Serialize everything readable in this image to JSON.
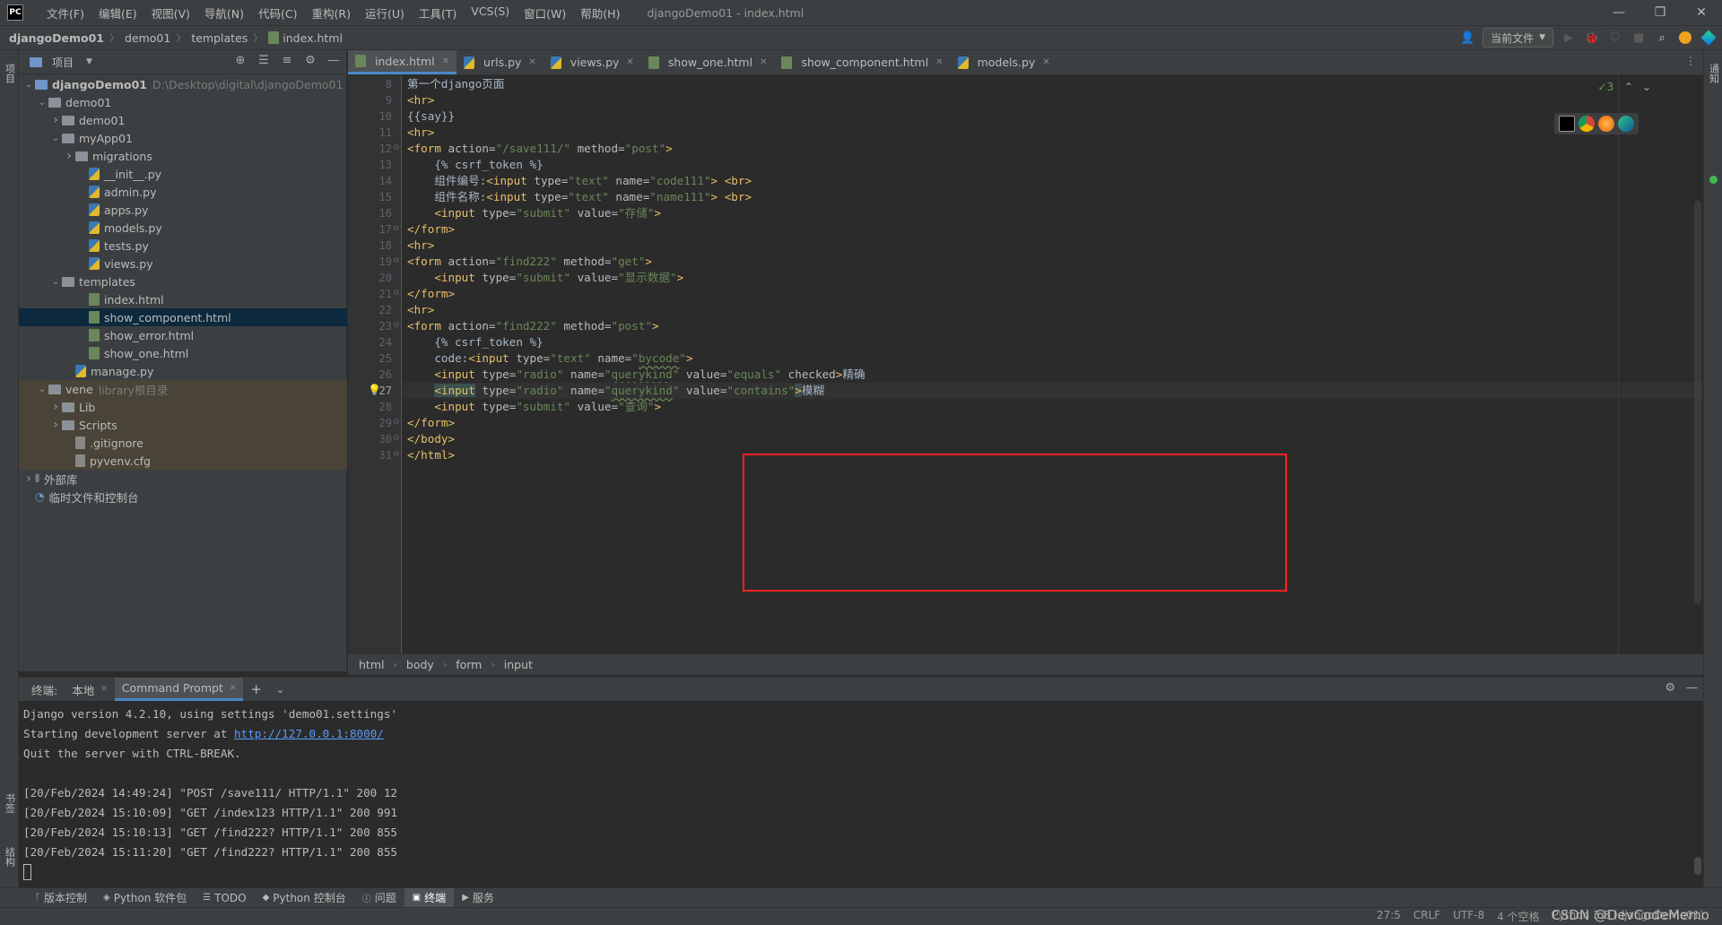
{
  "titlebar": {
    "logo": "PC",
    "menu": [
      "文件(F)",
      "编辑(E)",
      "视图(V)",
      "导航(N)",
      "代码(C)",
      "重构(R)",
      "运行(U)",
      "工具(T)",
      "VCS(S)",
      "窗口(W)",
      "帮助(H)"
    ],
    "window_title": "djangoDemo01 - index.html"
  },
  "navbar": {
    "crumbs": [
      "djangoDemo01",
      "demo01",
      "templates",
      "index.html"
    ],
    "run_config": "当前文件"
  },
  "stripes": {
    "project": "项目",
    "bookmarks": "书签",
    "structure": "结构",
    "notifications": "通知"
  },
  "project_panel": {
    "title": "项目",
    "tree": [
      {
        "label": "djangoDemo01",
        "extra": "D:\\Desktop\\digital\\djangoDemo01",
        "type": "folder-blue",
        "depth": 0,
        "arrow": "open",
        "bold": true
      },
      {
        "label": "demo01",
        "type": "folder",
        "depth": 1,
        "arrow": "open"
      },
      {
        "label": "demo01",
        "type": "folder",
        "depth": 2,
        "arrow": "closed"
      },
      {
        "label": "myApp01",
        "type": "folder",
        "depth": 2,
        "arrow": "open"
      },
      {
        "label": "migrations",
        "type": "folder",
        "depth": 3,
        "arrow": "closed"
      },
      {
        "label": "__init__.py",
        "type": "py",
        "depth": 4
      },
      {
        "label": "admin.py",
        "type": "py",
        "depth": 4
      },
      {
        "label": "apps.py",
        "type": "py",
        "depth": 4
      },
      {
        "label": "models.py",
        "type": "py",
        "depth": 4
      },
      {
        "label": "tests.py",
        "type": "py",
        "depth": 4
      },
      {
        "label": "views.py",
        "type": "py",
        "depth": 4
      },
      {
        "label": "templates",
        "type": "folder",
        "depth": 2,
        "arrow": "open"
      },
      {
        "label": "index.html",
        "type": "html",
        "depth": 4
      },
      {
        "label": "show_component.html",
        "type": "html",
        "depth": 4,
        "selected": true
      },
      {
        "label": "show_error.html",
        "type": "html",
        "depth": 4
      },
      {
        "label": "show_one.html",
        "type": "html",
        "depth": 4
      },
      {
        "label": "manage.py",
        "type": "py",
        "depth": 3
      },
      {
        "label": "vene",
        "extra": "library根目录",
        "type": "folder",
        "depth": 1,
        "arrow": "open",
        "excluded": true
      },
      {
        "label": "Lib",
        "type": "folder",
        "depth": 2,
        "arrow": "closed",
        "excluded": true
      },
      {
        "label": "Scripts",
        "type": "folder",
        "depth": 2,
        "arrow": "closed",
        "excluded": true
      },
      {
        "label": ".gitignore",
        "type": "gen",
        "depth": 3,
        "excluded": true
      },
      {
        "label": "pyvenv.cfg",
        "type": "gen",
        "depth": 3,
        "excluded": true
      },
      {
        "label": "外部库",
        "type": "lib",
        "depth": 0,
        "arrow": "closed"
      },
      {
        "label": "临时文件和控制台",
        "type": "scratch",
        "depth": 0
      }
    ]
  },
  "editor_tabs": [
    {
      "label": "index.html",
      "type": "html",
      "active": true
    },
    {
      "label": "urls.py",
      "type": "py"
    },
    {
      "label": "views.py",
      "type": "py"
    },
    {
      "label": "show_one.html",
      "type": "html"
    },
    {
      "label": "show_component.html",
      "type": "html"
    },
    {
      "label": "models.py",
      "type": "py"
    }
  ],
  "editor": {
    "inspection_count": "✓3",
    "current_line": 27,
    "lines": [
      {
        "n": "8",
        "html": "<span class=\"tx\">第一个django页面</span>"
      },
      {
        "n": "9",
        "html": "<span class=\"t\">&lt;hr&gt;</span>"
      },
      {
        "n": "10",
        "html": "<span class=\"tx\">{{say}}</span>"
      },
      {
        "n": "11",
        "html": "<span class=\"t\">&lt;hr&gt;</span>"
      },
      {
        "n": "12",
        "html": "<span class=\"t\">&lt;form </span><span class=\"a\">action=</span><span class=\"s\">\"/save111/\"</span><span class=\"a\"> method=</span><span class=\"s\">\"post\"</span><span class=\"t\">&gt;</span>"
      },
      {
        "n": "13",
        "html": "<span class=\"tx\">    {% csrf_token %}</span>"
      },
      {
        "n": "14",
        "html": "<span class=\"tx\">    组件编号:</span><span class=\"t\">&lt;input </span><span class=\"a\">type=</span><span class=\"s\">\"text\"</span><span class=\"a\"> name=</span><span class=\"s\">\"code111\"</span><span class=\"t\">&gt; &lt;br&gt;</span>"
      },
      {
        "n": "15",
        "html": "<span class=\"tx\">    组件名称:</span><span class=\"t\">&lt;input </span><span class=\"a\">type=</span><span class=\"s\">\"text\"</span><span class=\"a\"> name=</span><span class=\"s\">\"name111\"</span><span class=\"t\">&gt; &lt;br&gt;</span>"
      },
      {
        "n": "16",
        "html": "<span class=\"t\">    &lt;input </span><span class=\"a\">type=</span><span class=\"s\">\"submit\"</span><span class=\"a\"> value=</span><span class=\"s\">\"存储\"</span><span class=\"t\">&gt;</span>"
      },
      {
        "n": "17",
        "html": "<span class=\"t\">&lt;/form&gt;</span>"
      },
      {
        "n": "18",
        "html": "<span class=\"t\">&lt;hr&gt;</span>"
      },
      {
        "n": "19",
        "html": "<span class=\"t\">&lt;form </span><span class=\"a\">action=</span><span class=\"s\">\"find222\"</span><span class=\"a\"> method=</span><span class=\"s\">\"get\"</span><span class=\"t\">&gt;</span>"
      },
      {
        "n": "20",
        "html": "<span class=\"t\">    &lt;input </span><span class=\"a\">type=</span><span class=\"s\">\"submit\"</span><span class=\"a\"> value=</span><span class=\"s\">\"显示数据\"</span><span class=\"t\">&gt;</span>"
      },
      {
        "n": "21",
        "html": "<span class=\"t\">&lt;/form&gt;</span>"
      },
      {
        "n": "22",
        "html": "<span class=\"t\">&lt;hr&gt;</span>"
      },
      {
        "n": "23",
        "html": "<span class=\"t\">&lt;form </span><span class=\"a\">action=</span><span class=\"s\">\"find222\"</span><span class=\"a\"> method=</span><span class=\"s\">\"post\"</span><span class=\"t\">&gt;</span>"
      },
      {
        "n": "24",
        "html": "<span class=\"tx\">    {% csrf_token %}</span>"
      },
      {
        "n": "25",
        "html": "<span class=\"tx\">    code:</span><span class=\"t\">&lt;input </span><span class=\"a\">type=</span><span class=\"s\">\"text\"</span><span class=\"a\"> name=</span><span class=\"s\">\"<span class=\"sp\">bycode</span>\"</span><span class=\"t\">&gt;</span>"
      },
      {
        "n": "26",
        "html": "<span class=\"t\">    &lt;input </span><span class=\"a\">type=</span><span class=\"s\">\"radio\"</span><span class=\"a\"> name=</span><span class=\"s\">\"<span class=\"sp\">querykind</span>\"</span><span class=\"a\"> value=</span><span class=\"s\">\"equals\"</span><span class=\"a\"> checked</span><span class=\"t\">&gt;</span><span class=\"tx\">精确</span>"
      },
      {
        "n": "27",
        "html": "<span class=\"t\">    <span class=\"hl\">&lt;input</span> </span><span class=\"a\">type=</span><span class=\"s\">\"radio\"</span><span class=\"a\"> name=</span><span class=\"s\">\"<span class=\"sp\">querykind</span>\"</span><span class=\"a\"> value=</span><span class=\"s\">\"contains\"</span><span class=\"t hl\">&gt;</span><span class=\"tx\">模糊</span>"
      },
      {
        "n": "28",
        "html": "<span class=\"t\">    &lt;input </span><span class=\"a\">type=</span><span class=\"s\">\"submit\"</span><span class=\"a\"> value=</span><span class=\"s\">\"查询\"</span><span class=\"t\">&gt;</span>"
      },
      {
        "n": "29",
        "html": "<span class=\"t\">&lt;/form&gt;</span>"
      },
      {
        "n": "30",
        "html": "<span class=\"t\">&lt;/body&gt;</span>"
      },
      {
        "n": "31",
        "html": "<span class=\"t\">&lt;/html&gt;</span>"
      }
    ]
  },
  "editor_breadcrumb": [
    "html",
    "body",
    "form",
    "input"
  ],
  "terminal": {
    "label": "终端:",
    "tabs": [
      "本地",
      "Command Prompt"
    ],
    "active_tab": "Command Prompt",
    "lines": [
      {
        "text": "Django version 4.2.10, using settings 'demo01.settings'"
      },
      {
        "text": "Starting development server at ",
        "link": "http://127.0.0.1:8000/"
      },
      {
        "text": "Quit the server with CTRL-BREAK."
      },
      {
        "text": ""
      },
      {
        "text": "[20/Feb/2024 14:49:24] \"POST /save111/ HTTP/1.1\" 200 12"
      },
      {
        "text": "[20/Feb/2024 15:10:09] \"GET /index123 HTTP/1.1\" 200 991"
      },
      {
        "text": "[20/Feb/2024 15:10:13] \"GET /find222? HTTP/1.1\" 200 855"
      },
      {
        "text": "[20/Feb/2024 15:11:20] \"GET /find222? HTTP/1.1\" 200 855"
      }
    ]
  },
  "bottom_tools": [
    "版本控制",
    "Python 软件包",
    "TODO",
    "Python 控制台",
    "问题",
    "终端",
    "服务"
  ],
  "bottom_tools_active": "终端",
  "status": [
    "27:5",
    "CRLF",
    "UTF-8",
    "4 个空格",
    "Python 3.8 (djangoDemo01)"
  ],
  "watermark": "CSDN @DevCodeMemo"
}
